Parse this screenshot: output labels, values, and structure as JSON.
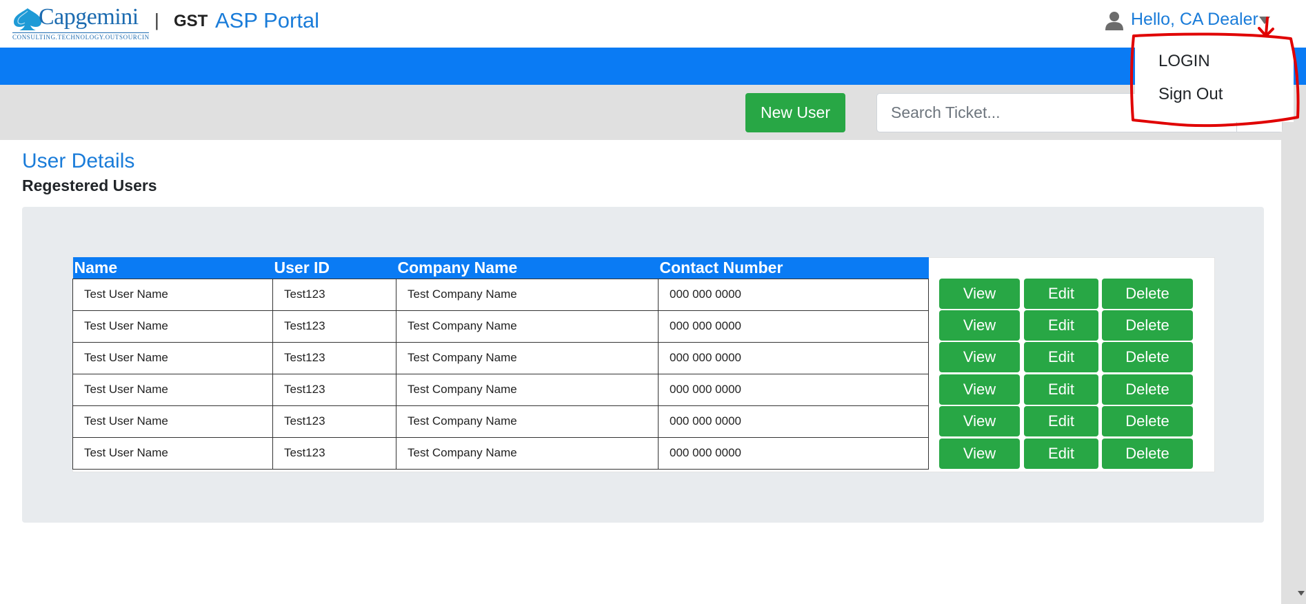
{
  "header": {
    "logo_text": "Capgemini",
    "logo_tagline": "CONSULTING.TECHNOLOGY.OUTSOURCING",
    "separator": "|",
    "app_prefix": "GST",
    "app_name": "ASP Portal",
    "user_greeting": "Hello, CA Dealer"
  },
  "dropdown": {
    "items": [
      "LOGIN",
      "Sign Out"
    ]
  },
  "toolbar": {
    "new_user_label": "New User",
    "search_placeholder": "Search Ticket..."
  },
  "page": {
    "title": "User Details",
    "subtitle": "Regestered Users"
  },
  "table": {
    "columns": [
      "Name",
      "User ID",
      "Company Name",
      "Contact Number"
    ],
    "rows": [
      [
        "Test User Name",
        "Test123",
        "Test Company Name",
        "000 000 0000"
      ],
      [
        "Test User Name",
        "Test123",
        "Test Company Name",
        "000 000 0000"
      ],
      [
        "Test User Name",
        "Test123",
        "Test Company Name",
        "000 000 0000"
      ],
      [
        "Test User Name",
        "Test123",
        "Test Company Name",
        "000 000 0000"
      ],
      [
        "Test User Name",
        "Test123",
        "Test Company Name",
        "000 000 0000"
      ],
      [
        "Test User Name",
        "Test123",
        "Test Company Name",
        "000 000 0000"
      ]
    ],
    "actions": [
      "View",
      "Edit",
      "Delete"
    ]
  },
  "colors": {
    "primary_blue": "#0a7bf4",
    "action_green": "#28a745",
    "annotation_red": "#e00000"
  },
  "icons": {
    "user": "user-icon",
    "caret": "caret-down-icon",
    "search": "search-icon"
  }
}
